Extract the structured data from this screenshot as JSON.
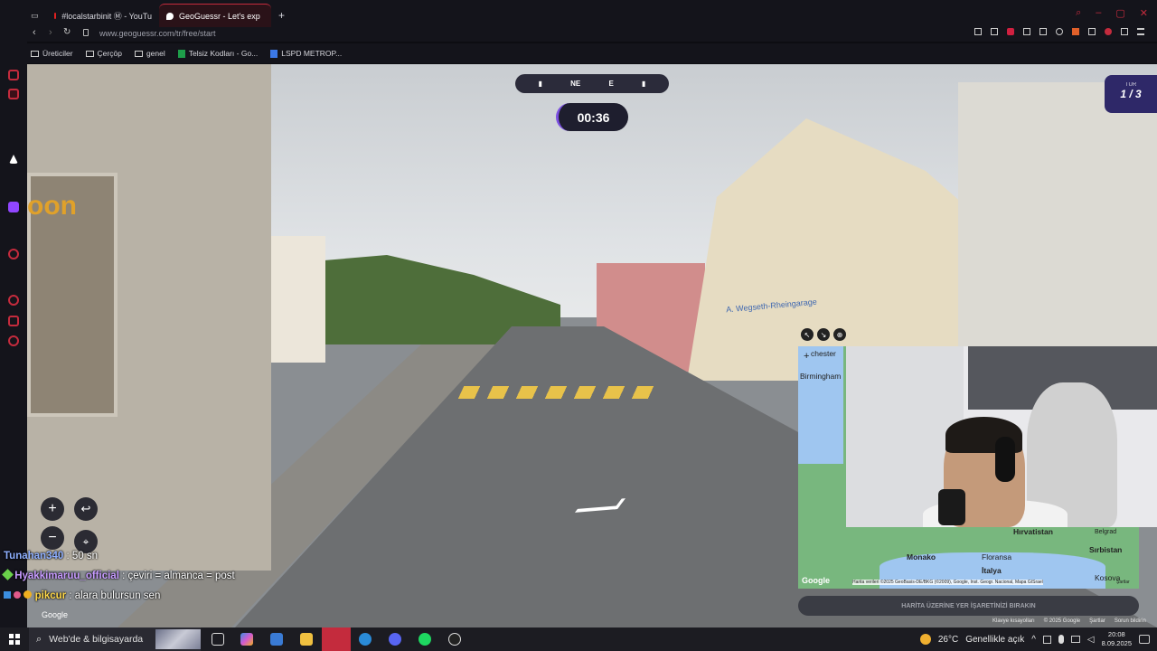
{
  "browser": {
    "tabs": [
      {
        "label": "#localstarbinit Ⓜ - YouTu",
        "active": false
      },
      {
        "label": "GeoGuessr - Let's exp",
        "active": true
      }
    ],
    "url": "www.geoguessr.com/tr/free/start",
    "bookmarks": [
      "Üreticiler",
      "Çerçöp",
      "genel",
      "Telsiz Kodları - Go...",
      "LSPD METROP..."
    ]
  },
  "game": {
    "compass": [
      "NE",
      "E"
    ],
    "timer": "00:36",
    "round_label": "TUR",
    "round_value": "1 / 3",
    "guess_button": "HARİTA ÜZERİNE YER İŞARETİNİZİ BIRAKIN",
    "street_sign": "A. Wegseth-Rheingarage",
    "shop_sign": "oon",
    "map_labels": [
      "chester",
      "Birmingham",
      "Monako",
      "Floransa",
      "İtalya",
      "Hırvatistan",
      "Sırbistan",
      "Belgrad",
      "Kosova"
    ],
    "map_attribution": "Harita verileri ©2025 GeoBasis-DE/BKG (©2009), Google, Inst. Geogr. Nacional, Mapa GISrael",
    "map_terms": "Şartlar",
    "google_logo": "Google",
    "credits": [
      "Klavye kısayolları",
      "© 2025 Google",
      "Şartlar",
      "Sorun bildirin"
    ]
  },
  "chat": [
    {
      "user": "Tunahan340",
      "message": ": 50 sn"
    },
    {
      "user": "Hyakkimaruu_official",
      "message": ": çeviri = almanca = post"
    },
    {
      "user": "pikcur",
      "message": ": alara bulursun sen"
    }
  ],
  "taskbar": {
    "search_placeholder": "Web'de & bilgisayarda",
    "weather": "26°C",
    "weather_text": "Genellikle açık",
    "time": "20:08",
    "date": "8.09.2025"
  },
  "colors": {
    "accent": "#c42b3d",
    "timer_ring": "#7b4fe0",
    "round_bg": "#2e2868"
  }
}
